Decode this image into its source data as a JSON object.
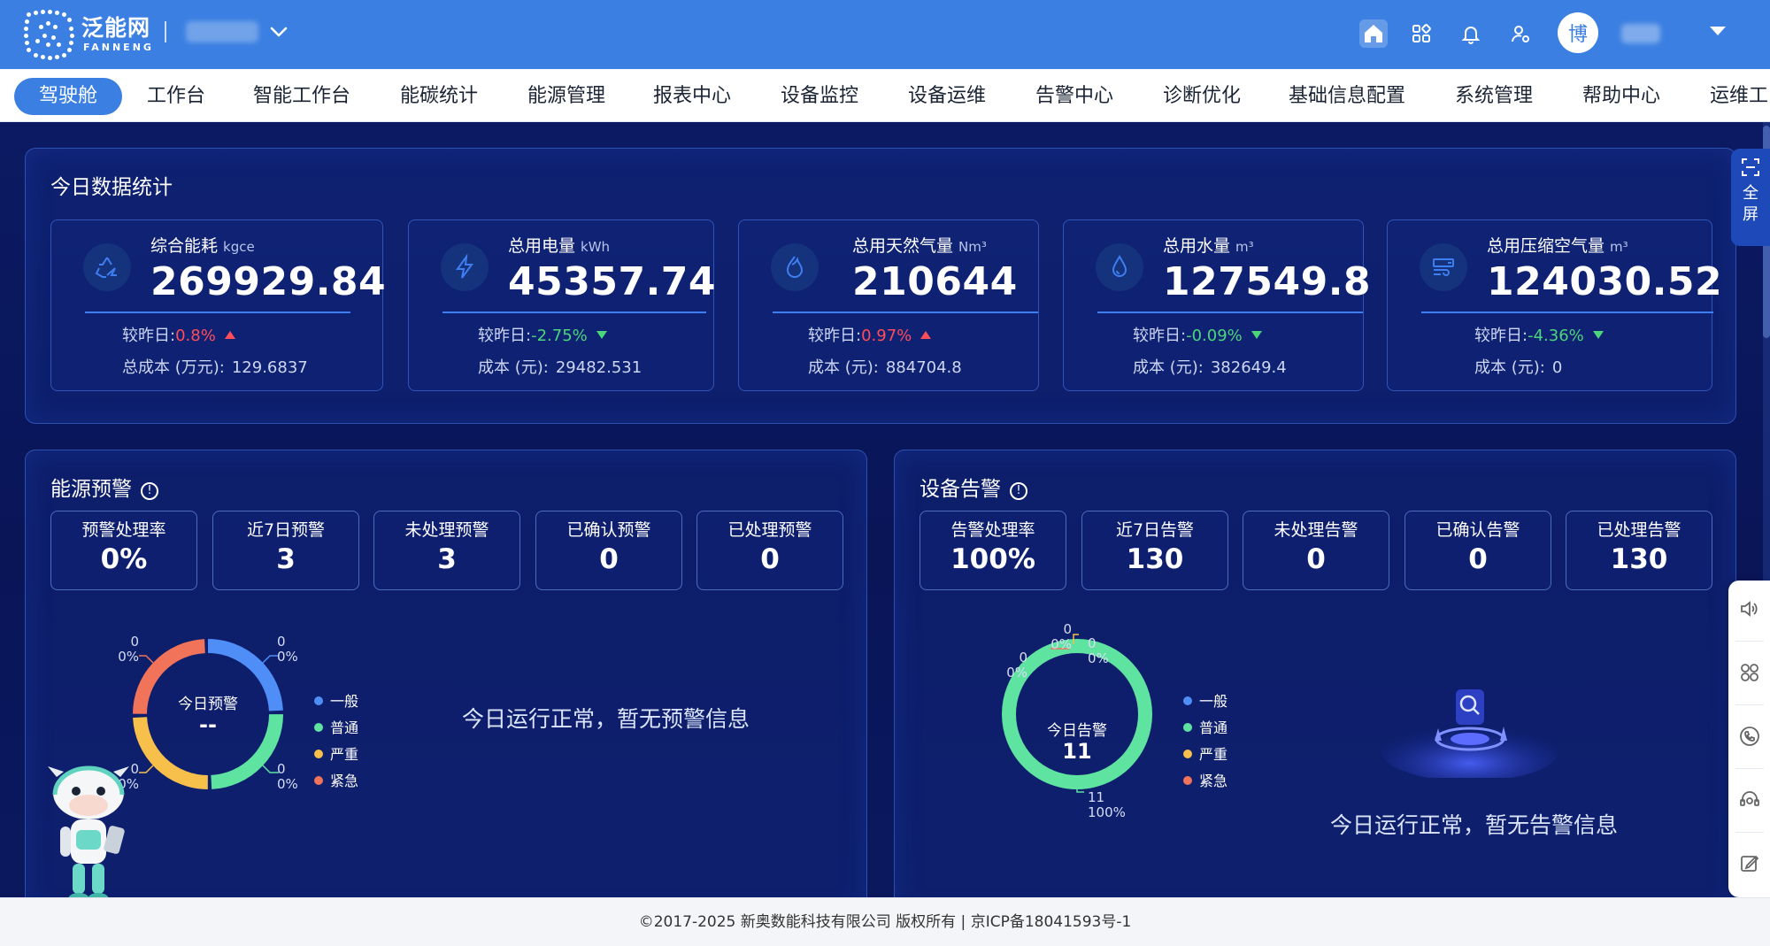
{
  "header": {
    "logo_name": "泛能网",
    "logo_sub": "FANNENG",
    "avatar_char": "博"
  },
  "nav": {
    "items": [
      "驾驶舱",
      "工作台",
      "智能工作台",
      "能碳统计",
      "能源管理",
      "报表中心",
      "设备监控",
      "设备运维",
      "告警中心",
      "诊断优化",
      "基础信息配置",
      "系统管理",
      "帮助中心",
      "运维工..."
    ],
    "active_index": 0
  },
  "today_stats": {
    "title": "今日数据统计",
    "cards": [
      {
        "label": "综合能耗",
        "unit": "kgce",
        "value": "269929.84",
        "cmp_label": "较昨日:",
        "cmp_value": "0.8%",
        "trend": "up",
        "cost_label": "总成本 (万元):",
        "cost_value": "129.6837",
        "icon": "recycle-icon"
      },
      {
        "label": "总用电量",
        "unit": "kWh",
        "value": "45357.74",
        "cmp_label": "较昨日:",
        "cmp_value": "-2.75%",
        "trend": "down",
        "cost_label": "成本 (元):",
        "cost_value": "29482.531",
        "icon": "lightning-icon"
      },
      {
        "label": "总用天然气量",
        "unit": "Nm³",
        "value": "210644",
        "cmp_label": "较昨日:",
        "cmp_value": "0.97%",
        "trend": "up",
        "cost_label": "成本 (元):",
        "cost_value": "884704.8",
        "icon": "flame-icon"
      },
      {
        "label": "总用水量",
        "unit": "m³",
        "value": "127549.8",
        "cmp_label": "较昨日:",
        "cmp_value": "-0.09%",
        "trend": "down",
        "cost_label": "成本 (元):",
        "cost_value": "382649.4",
        "icon": "water-drop-icon"
      },
      {
        "label": "总用压缩空气量",
        "unit": "m³",
        "value": "124030.52",
        "cmp_label": "较昨日:",
        "cmp_value": "-4.36%",
        "trend": "down",
        "cost_label": "成本 (元):",
        "cost_value": "0",
        "icon": "wind-icon"
      }
    ]
  },
  "energy_warning": {
    "title": "能源预警",
    "kpis": [
      {
        "label": "预警处理率",
        "value": "0%"
      },
      {
        "label": "近7日预警",
        "value": "3"
      },
      {
        "label": "未处理预警",
        "value": "3"
      },
      {
        "label": "已确认预警",
        "value": "0"
      },
      {
        "label": "已处理预警",
        "value": "0"
      }
    ],
    "donut_title": "今日预警",
    "donut_value": "--",
    "slice_labels": {
      "tl": [
        "0",
        "0%"
      ],
      "tr": [
        "0",
        "0%"
      ],
      "br": [
        "0",
        "0%"
      ],
      "bl": [
        "0",
        "0%"
      ]
    },
    "legend": [
      "一般",
      "普通",
      "严重",
      "紧急"
    ],
    "empty_message": "今日运行正常，暂无预警信息"
  },
  "device_alarm": {
    "title": "设备告警",
    "kpis": [
      {
        "label": "告警处理率",
        "value": "100%"
      },
      {
        "label": "近7日告警",
        "value": "130"
      },
      {
        "label": "未处理告警",
        "value": "0"
      },
      {
        "label": "已确认告警",
        "value": "0"
      },
      {
        "label": "已处理告警",
        "value": "130"
      }
    ],
    "donut_title": "今日告警",
    "donut_value": "11",
    "slice_labels": {
      "top1": [
        "0",
        "0%"
      ],
      "top2": [
        "0",
        "0%"
      ],
      "left": [
        "0",
        "0%"
      ],
      "bottom": [
        "11",
        "100%"
      ]
    },
    "legend": [
      "一般",
      "普通",
      "严重",
      "紧急"
    ],
    "empty_message": "今日运行正常，暂无告警信息"
  },
  "legend_colors": {
    "一般": "#4f8ef7",
    "普通": "#5fe3a1",
    "严重": "#f7c04a",
    "紧急": "#f0735a"
  },
  "fullscreen_label": [
    "全",
    "屏"
  ],
  "footer": {
    "text": "©2017-2025 新奥数能科技有限公司 版权所有 | 京ICP备18041593号-1"
  }
}
